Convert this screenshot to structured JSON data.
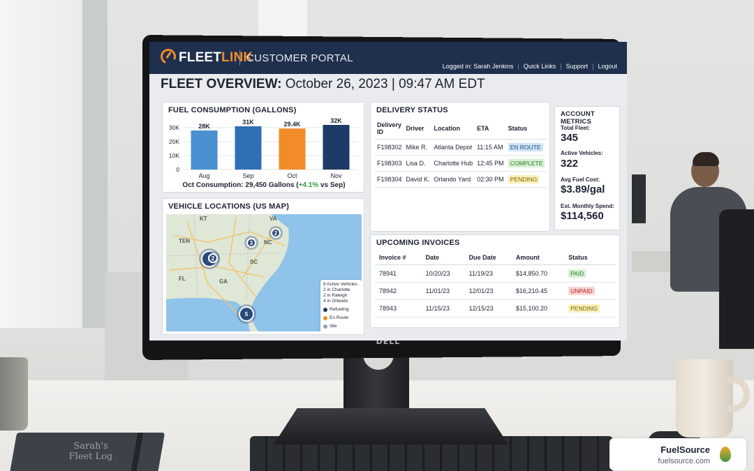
{
  "header": {
    "brand_fleet": "FLEET",
    "brand_link": "LINK",
    "portal_title": "CUSTOMER PORTAL",
    "nav": [
      "Logged in: Sarah Jenkins",
      "Quick Links",
      "Support",
      "Logout"
    ]
  },
  "page": {
    "title": "FLEET OVERVIEW:",
    "timestamp": "October 26, 2023 | 09:47 AM EDT"
  },
  "fuel": {
    "title": "FUEL CONSUMPTION (GALLONS)",
    "summary_prefix": "Oct Consumption: 29,450 Gallons (",
    "summary_change": "+4.1%",
    "summary_suffix": " vs Sep)"
  },
  "chart_data": {
    "type": "bar",
    "title": "FUEL CONSUMPTION (GALLONS)",
    "categories": [
      "Aug",
      "Sep",
      "Oct",
      "Nov"
    ],
    "values": [
      28000,
      31000,
      29400,
      32000
    ],
    "data_labels": [
      "28K",
      "31K",
      "29.4K",
      "32K"
    ],
    "bar_colors": [
      "#4a8fd0",
      "#2f6fb3",
      "#f28c28",
      "#1f3a66"
    ],
    "yticks": [
      "0",
      "10K",
      "20K",
      "30K"
    ],
    "ylim": [
      0,
      35000
    ],
    "xlabel": "",
    "ylabel": "",
    "grid": true
  },
  "map": {
    "title": "VEHICLE LOCATIONS (US MAP)",
    "labels": [
      "KT",
      "VA",
      "TEN",
      "NC",
      "SC",
      "FL",
      "GA"
    ],
    "clusters": [
      "5",
      "2",
      "3",
      "2",
      "5"
    ],
    "legend_lines": [
      "8 Active Vehicles",
      "2 in Charlotte",
      "2 in Raleigh",
      "4 in Orlando"
    ],
    "legend_status": [
      "Refueling",
      "En Route",
      "Idle"
    ],
    "status_colors": [
      "#1f3a66",
      "#f28c28",
      "#9aa0a6"
    ]
  },
  "delivery": {
    "title": "DELIVERY STATUS",
    "columns": [
      "Delivery ID",
      "Driver",
      "Location",
      "ETA",
      "Status"
    ],
    "rows": [
      {
        "id": "F198302",
        "driver": "Mike R.",
        "location": "Atlanta Depot",
        "eta": "11:15 AM",
        "status": "EN ROUTE",
        "bg": "#cfe3f7",
        "fg": "#1f4f86"
      },
      {
        "id": "F198303",
        "driver": "Lisa D.",
        "location": "Charlotte Hub",
        "eta": "12:45 PM",
        "status": "COMPLETE",
        "bg": "#d6f0d3",
        "fg": "#2e7d32"
      },
      {
        "id": "F198304",
        "driver": "David K.",
        "location": "Orlando Yard",
        "eta": "02:30 PM",
        "status": "PENDING",
        "bg": "#fbf0b8",
        "fg": "#7a6300"
      }
    ]
  },
  "metrics": {
    "title": "ACCOUNT METRICS",
    "items": [
      {
        "label": "Total Fleet:",
        "value": "345"
      },
      {
        "label": "Active Vehicles:",
        "value": "322"
      },
      {
        "label": "Avg Fuel Cost:",
        "value": "$3.89/gal"
      },
      {
        "label": "Est. Monthly Spend:",
        "value": "$114,560"
      }
    ]
  },
  "invoices": {
    "title": "UPCOMING INVOICES",
    "columns": [
      "Invoice #",
      "Date",
      "Due Date",
      "Amount",
      "Status"
    ],
    "rows": [
      {
        "num": "78941",
        "date": "10/20/23",
        "due": "11/19/23",
        "amount": "$14,850.70",
        "status": "PAID",
        "bg": "#d6f0d3",
        "fg": "#2e7d32"
      },
      {
        "num": "78942",
        "date": "11/01/23",
        "due": "12/01/23",
        "amount": "$16,210.45",
        "status": "UNPAID",
        "bg": "#f9d3d3",
        "fg": "#b3261e"
      },
      {
        "num": "78943",
        "date": "11/15/23",
        "due": "12/15/23",
        "amount": "$15,100.20",
        "status": "PENDING",
        "bg": "#fbf0b8",
        "fg": "#7a6300"
      }
    ]
  },
  "desk": {
    "notebook_line1": "Sarah's",
    "notebook_line2": "Fleet Log",
    "monitor_brand": "DELL"
  },
  "watermark": {
    "name": "FuelSource",
    "url": "fuelsource.com"
  }
}
